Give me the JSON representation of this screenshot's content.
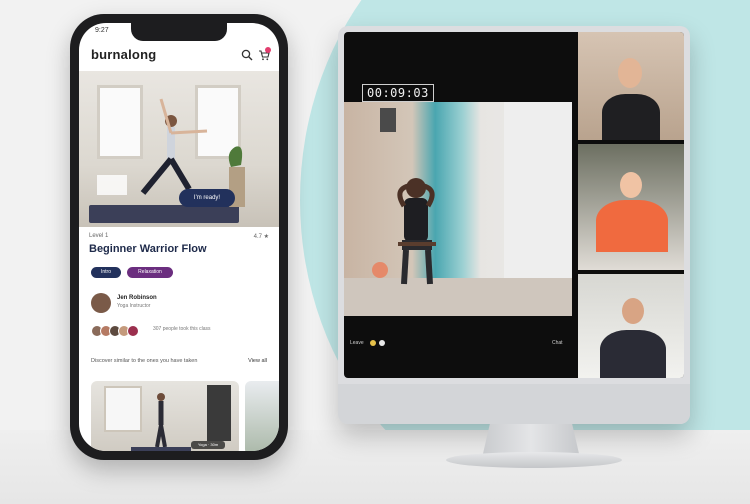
{
  "phone": {
    "status_time": "9:27",
    "brand": "burnalong",
    "hero_button": "I'm ready!",
    "level": "Level 1",
    "rating": "4.7 ★",
    "class_title": "Beginner Warrior Flow",
    "chips": [
      "Intro",
      "Relaxation"
    ],
    "instructor_name": "Jen Robinson",
    "instructor_role": "Yoga Instructor",
    "people_text": "307 people took this class",
    "section_label": "Discover similar to the ones you have taken",
    "view_all": "View all",
    "thumb_tag": "Yoga · 30m"
  },
  "monitor": {
    "timer": "00:09:03",
    "controls": [
      "Leave",
      "Chat"
    ]
  },
  "colors": {
    "brand_navy": "#22315c",
    "accent_purple": "#6b2e7f",
    "teal_background": "#bfe6e6",
    "notification_pink": "#e23d6e"
  }
}
